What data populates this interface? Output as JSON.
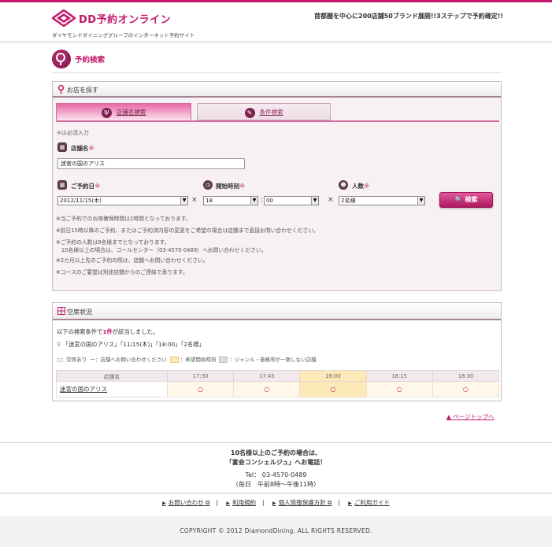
{
  "header": {
    "title": "DD予約オンライン",
    "subtitle": "ダイヤモンドダイニンググループのインターネット予約サイト",
    "catchcopy": "首都圏を中心に200店舗50ブランド展開!!3ステップで予約確定!!"
  },
  "page_title": "予約検索",
  "search_panel": {
    "heading": "お店を探す",
    "tabs": [
      {
        "label": "店舗名検索",
        "active": true
      },
      {
        "label": "条件検索",
        "active": false
      }
    ],
    "required_note": "※は必須入力",
    "store_label": "店舗名",
    "store_value": "迷宮の国のアリス",
    "date_label": "ご予約日",
    "date_value": "2012/11/15(木)",
    "time_label": "開始時刻",
    "hour_value": "18",
    "minute_value": "00",
    "people_label": "人数",
    "people_value": "2名様",
    "search_button": "検索",
    "required_mark": "※",
    "notes": [
      "※当ご予約でのお席確保時間は2時間となっております。",
      "※前日15時以降のご予約、またはご予約済内容の変更をご希望の場合は店舗まで直接お問い合わせください。",
      "※ご予約の人数は9名様までとなっております。",
      "　10名様以上の場合は、コールセンター（03-4570-0489）へお問い合わせください。",
      "※2カ月以上先のご予約の際は、店舗へお問い合わせください。",
      "※コースのご要望は別途店舗からのご連絡で承ります。"
    ]
  },
  "availability_panel": {
    "heading": "空席状況",
    "result_prefix": "以下の検索条件で",
    "result_count": "1件",
    "result_suffix": "が該当しました。",
    "query": "「迷宮の国のアリス」「11/15(木)」「18:00」「2名様」",
    "legend": {
      "available": "○：空席あり",
      "contact": "ー：店舗へお問い合わせください",
      "requested": "：希望開始時刻",
      "mismatch": "：ジャンル・価格帯が一致しない店舗"
    },
    "table": {
      "store_header": "店舗名",
      "times": [
        "17:30",
        "17:45",
        "18:00",
        "18:15",
        "18:30"
      ],
      "highlight_time": "18:00",
      "rows": [
        {
          "name": "迷宮の国のアリス",
          "slots": [
            "○",
            "○",
            "○",
            "○",
            "○"
          ]
        }
      ]
    }
  },
  "pagetop": "ページトップへ",
  "footer": {
    "line1": "10名様以上のご予約の場合は、",
    "line2": "「宴会コンシェルジュ」へお電話！",
    "tel": "Tel： 03-4570-0489",
    "hours": "（毎日　午前8時〜午後11時）",
    "links": [
      "お問い合わせ",
      "利用規約",
      "個人情報保護方針",
      "ご利用ガイド"
    ],
    "copyright": "COPYRIGHT © 2012 DiamondDining. ALL RIGHTS RESERVED."
  },
  "colors": {
    "brand": "#c2186b",
    "panel_bg": "#f7f1f4",
    "highlight": "#fde8b8"
  }
}
